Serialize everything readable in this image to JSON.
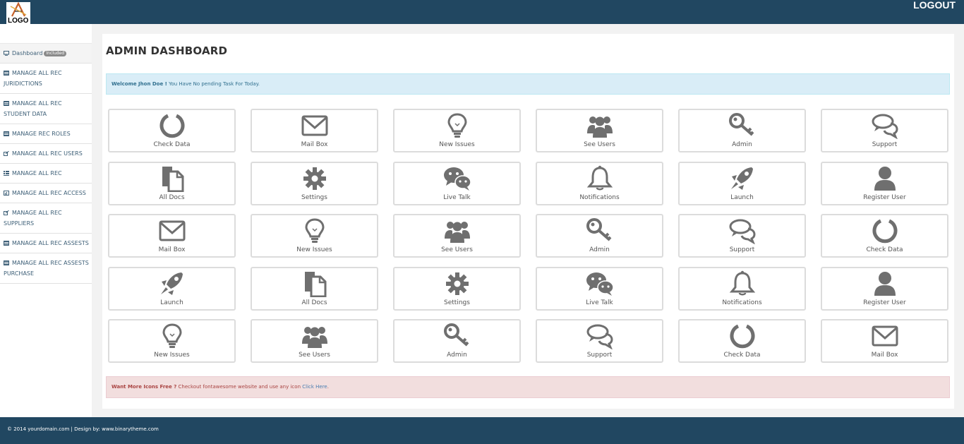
{
  "header": {
    "logo_text": "LOGO",
    "logout_label": "LOGOUT",
    "bar_color": "#214761"
  },
  "sidebar": {
    "items": [
      {
        "label": "Dashboard",
        "badge": "Included",
        "icon": "desktop-icon"
      },
      {
        "label": "MANAGE ALL REC JURIDICTIONS",
        "icon": "table-icon"
      },
      {
        "label": "MANAGE ALL REC STUDENT DATA",
        "icon": "table-icon"
      },
      {
        "label": "MANAGE REC ROLES",
        "icon": "table-icon"
      },
      {
        "label": "MANAGE ALL REC USERS",
        "icon": "edit-icon"
      },
      {
        "label": "MANAGE ALL REC",
        "icon": "list-icon"
      },
      {
        "label": "MANAGE ALL REC ACCESS",
        "icon": "chart-icon"
      },
      {
        "label": "MANAGE ALL REC SUPPLIERS",
        "icon": "edit-icon"
      },
      {
        "label": "MANAGE ALL REC ASSESTS",
        "icon": "table-icon"
      },
      {
        "label": "MANAGE ALL REC ASSESTS PURCHASE",
        "icon": "table-icon"
      }
    ]
  },
  "main": {
    "title": "ADMIN DASHBOARD",
    "welcome": {
      "bold": "Welcome Jhon Doe !",
      "text": " You Have No pending Task For Today."
    },
    "promo": {
      "bold": "Want More Icons Free ?",
      "text": " Checkout fontawesome website and use any icon ",
      "link": "Click Here",
      "after": "."
    },
    "tiles": [
      [
        {
          "label": "Check Data",
          "icon": "circle-notch-icon"
        },
        {
          "label": "Mail Box",
          "icon": "envelope-icon"
        },
        {
          "label": "New Issues",
          "icon": "lightbulb-icon"
        },
        {
          "label": "See Users",
          "icon": "users-icon"
        },
        {
          "label": "Admin",
          "icon": "key-icon"
        },
        {
          "label": "Support",
          "icon": "comments-icon"
        }
      ],
      [
        {
          "label": "All Docs",
          "icon": "copy-icon"
        },
        {
          "label": "Settings",
          "icon": "gear-icon"
        },
        {
          "label": "Live Talk",
          "icon": "wechat-icon"
        },
        {
          "label": "Notifications",
          "icon": "bell-icon"
        },
        {
          "label": "Launch",
          "icon": "rocket-icon"
        },
        {
          "label": "Register User",
          "icon": "user-icon"
        }
      ],
      [
        {
          "label": "Mail Box",
          "icon": "envelope-icon"
        },
        {
          "label": "New Issues",
          "icon": "lightbulb-icon"
        },
        {
          "label": "See Users",
          "icon": "users-icon"
        },
        {
          "label": "Admin",
          "icon": "key-icon"
        },
        {
          "label": "Support",
          "icon": "comments-icon"
        },
        {
          "label": "Check Data",
          "icon": "circle-notch-icon"
        }
      ],
      [
        {
          "label": "Launch",
          "icon": "rocket-icon"
        },
        {
          "label": "All Docs",
          "icon": "copy-icon"
        },
        {
          "label": "Settings",
          "icon": "gear-icon"
        },
        {
          "label": "Live Talk",
          "icon": "wechat-icon"
        },
        {
          "label": "Notifications",
          "icon": "bell-icon"
        },
        {
          "label": "Register User",
          "icon": "user-icon"
        }
      ],
      [
        {
          "label": "New Issues",
          "icon": "lightbulb-icon"
        },
        {
          "label": "See Users",
          "icon": "users-icon"
        },
        {
          "label": "Admin",
          "icon": "key-icon"
        },
        {
          "label": "Support",
          "icon": "comments-icon"
        },
        {
          "label": "Check Data",
          "icon": "circle-notch-icon"
        },
        {
          "label": "Mail Box",
          "icon": "envelope-icon"
        }
      ]
    ]
  },
  "footer": {
    "text": "© 2014 yourdomain.com | Design by: www.binarytheme.com"
  }
}
